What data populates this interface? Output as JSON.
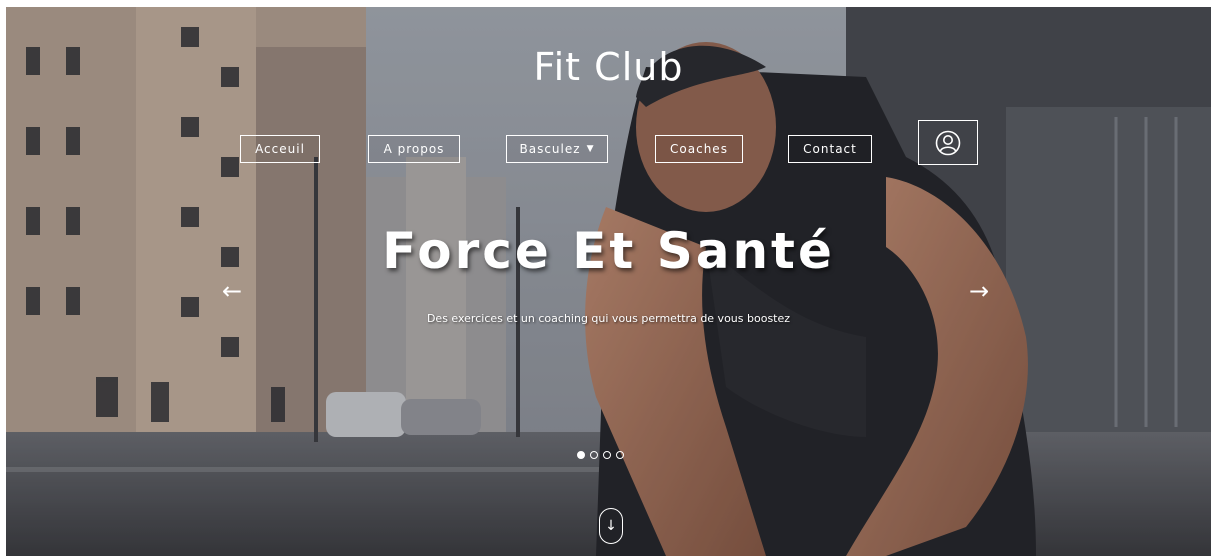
{
  "brand": {
    "title": "Fit Club"
  },
  "nav": {
    "items": [
      {
        "label": "Acceuil"
      },
      {
        "label": "A propos"
      },
      {
        "label": "Basculez"
      },
      {
        "label": "Coaches"
      },
      {
        "label": "Contact"
      }
    ],
    "user_icon": "user-icon"
  },
  "hero": {
    "title": "Force Et Santé",
    "subtitle": "Des exercices et un coaching qui vous permettra de vous boostez"
  },
  "carousel": {
    "prev": "←",
    "next": "→",
    "slides_count": 4,
    "active_index": 0
  },
  "scroll": {
    "icon": "↓"
  }
}
